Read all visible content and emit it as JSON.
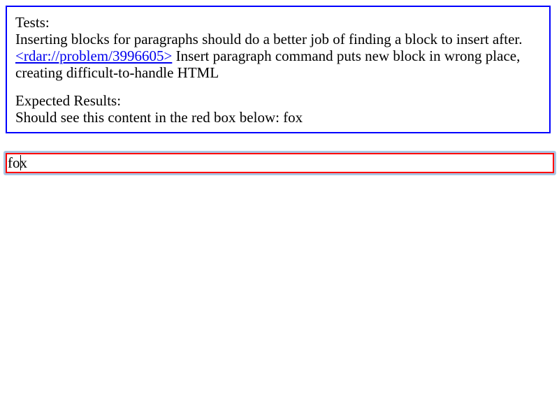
{
  "explanation": {
    "tests_heading": "Tests:",
    "description_before_link": "Inserting blocks for paragraphs should do a better job of finding a block to insert after. ",
    "link_text": "<rdar://problem/3996605>",
    "description_after_link": " Insert paragraph command puts new block in wrong place, creating difficult-to-handle HTML",
    "expected_heading": "Expected Results:",
    "expected_text": "Should see this content in the red box below: fox"
  },
  "editable": {
    "text_before_caret": "fo",
    "text_after_caret": "x"
  },
  "colors": {
    "explanation_border": "#0000ff",
    "edit_border": "#ff0000",
    "focus_ring": "#a9c6e3",
    "link": "#0000ee"
  }
}
